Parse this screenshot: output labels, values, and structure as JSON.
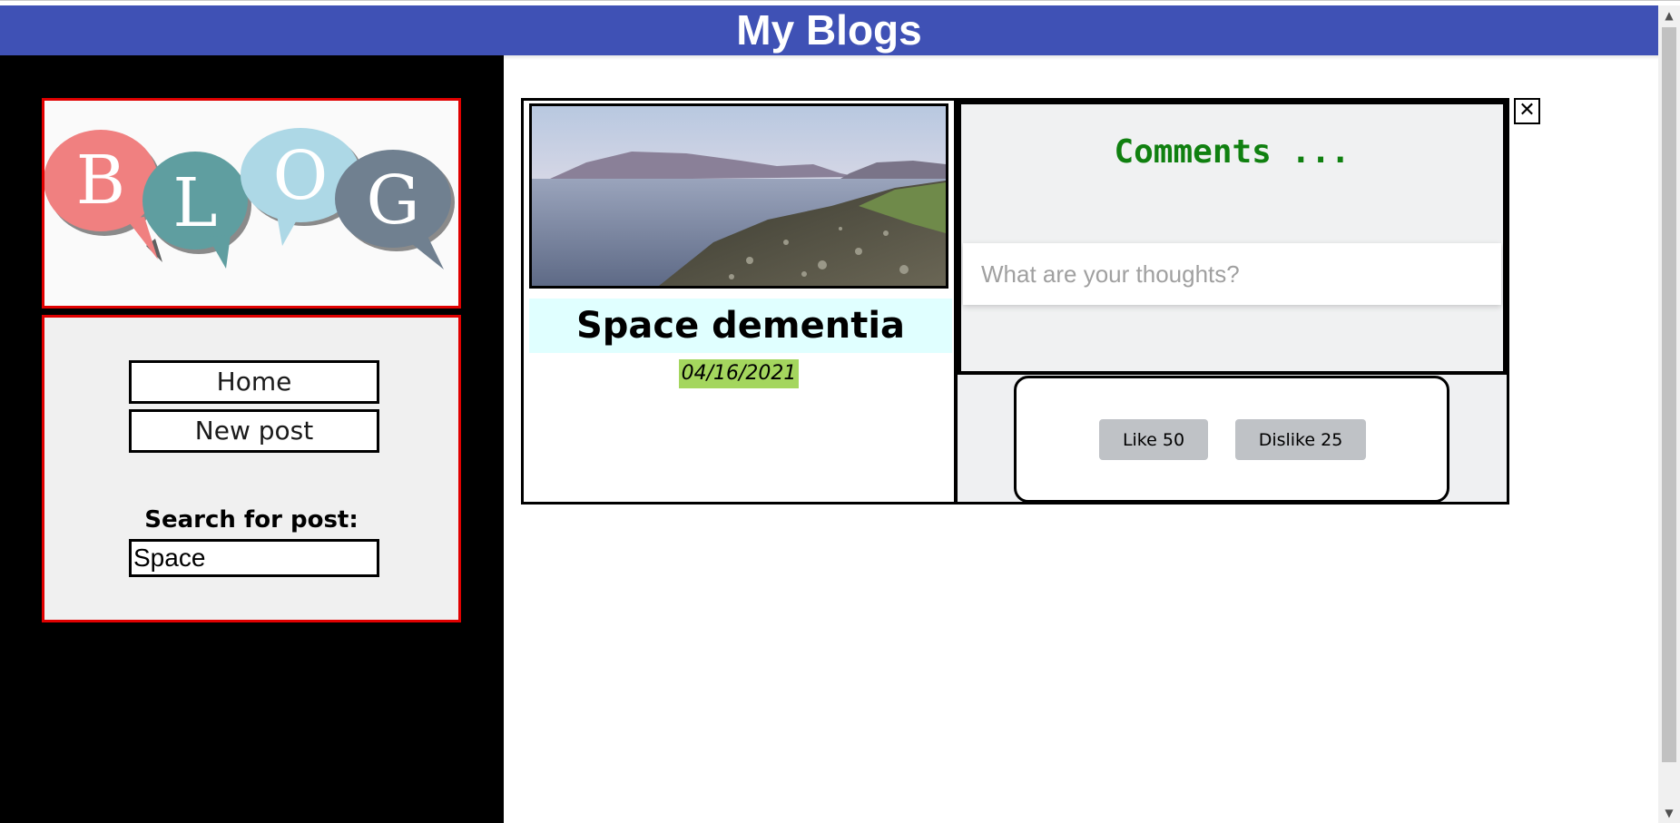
{
  "header": {
    "title": "My Blogs"
  },
  "sidebar": {
    "logo": {
      "letters": [
        "B",
        "L",
        "O",
        "G"
      ],
      "colors": [
        "#f08080",
        "#5f9ea0",
        "#add8e6",
        "#708090"
      ]
    },
    "nav": {
      "home_label": "Home",
      "new_post_label": "New post"
    },
    "search": {
      "label": "Search for post:",
      "value": "Space"
    }
  },
  "post": {
    "title": "Space dementia",
    "date": "04/16/2021",
    "image": "coastline-landscape"
  },
  "comments": {
    "title": "Comments ...",
    "placeholder": "What are your thoughts?"
  },
  "reactions": {
    "like_label": "Like 50",
    "dislike_label": "Dislike 25"
  },
  "close": {
    "label": "✕"
  },
  "colors": {
    "header": "#3f51b5",
    "sidebar": "#000000",
    "accent_border": "#e00000",
    "comments_title": "#108010",
    "date_bg": "#a4d65e",
    "title_bg": "#e0ffff"
  }
}
